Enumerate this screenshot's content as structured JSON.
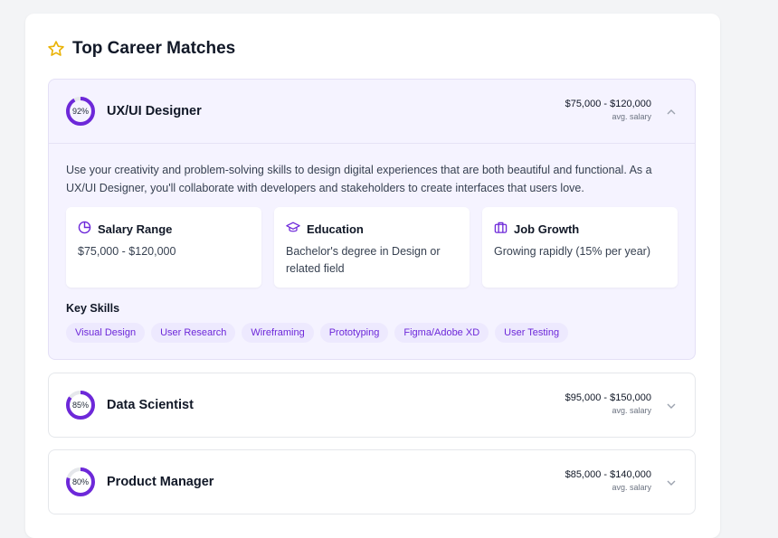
{
  "header": {
    "title": "Top Career Matches",
    "icon": "star-icon",
    "icon_color": "#eab308"
  },
  "accent_color": "#6d28d9",
  "careers": [
    {
      "match": "92%",
      "match_value": 0.92,
      "title": "UX/UI Designer",
      "salary": "$75,000 - $120,000",
      "salary_sub": "avg. salary",
      "expanded": true,
      "description": "Use your creativity and problem-solving skills to design digital experiences that are both beautiful and functional. As a UX/UI Designer, you'll collaborate with developers and stakeholders to create interfaces that users love.",
      "details": [
        {
          "icon": "pie-chart-icon",
          "label": "Salary Range",
          "value": "$75,000 - $120,000"
        },
        {
          "icon": "graduation-cap-icon",
          "label": "Education",
          "value": "Bachelor's degree in Design or related field"
        },
        {
          "icon": "briefcase-icon",
          "label": "Job Growth",
          "value": "Growing rapidly (15% per year)"
        }
      ],
      "skills_title": "Key Skills",
      "skills": [
        "Visual Design",
        "User Research",
        "Wireframing",
        "Prototyping",
        "Figma/Adobe XD",
        "User Testing"
      ]
    },
    {
      "match": "85%",
      "match_value": 0.85,
      "title": "Data Scientist",
      "salary": "$95,000 - $150,000",
      "salary_sub": "avg. salary",
      "expanded": false
    },
    {
      "match": "80%",
      "match_value": 0.8,
      "title": "Product Manager",
      "salary": "$85,000 - $140,000",
      "salary_sub": "avg. salary",
      "expanded": false
    }
  ]
}
